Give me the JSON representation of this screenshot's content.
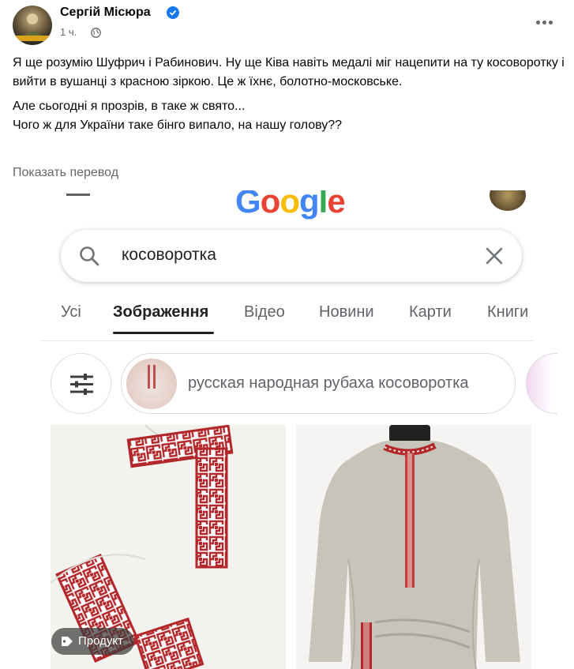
{
  "post": {
    "author": "Сергій Місюра",
    "time": "1 ч.",
    "paragraph1": "Я ще розумію Шуфрич і Рабинович. Ну ще Ківа навіть медалі міг нацепити на ту косоворотку і вийти в вушанці з красною зіркою. Це ж їхнє, болотно-московське.",
    "paragraph2_line1": "Але сьогодні я прозрів, в таке ж свято...",
    "paragraph2_line2": "Чого ж для України таке бінго випало, на нашу голову??",
    "translate_link": "Показать перевод"
  },
  "google": {
    "logo_letters": [
      "G",
      "o",
      "o",
      "g",
      "l",
      "e"
    ],
    "search": {
      "value": "косоворотка"
    },
    "tabs": [
      {
        "label": "Усі"
      },
      {
        "label": "Зображення"
      },
      {
        "label": "Відео"
      },
      {
        "label": "Новини"
      },
      {
        "label": "Карти"
      },
      {
        "label": "Книги"
      }
    ],
    "active_tab": "Зображення",
    "chip_label": "русская народная рубаха косоворотка",
    "product_badge": "Продукт"
  },
  "colors": {
    "facebook_blue": "#1877f2",
    "embroidery_red": "#b3262a",
    "google_blue": "#4285f4",
    "google_red": "#ea4335",
    "google_yellow": "#fbbc05",
    "google_green": "#34a853"
  },
  "icons": [
    "verified-badge-icon",
    "globe-icon",
    "more-options-icon",
    "search-icon",
    "close-icon",
    "filter-sliders-icon",
    "tag-icon"
  ]
}
